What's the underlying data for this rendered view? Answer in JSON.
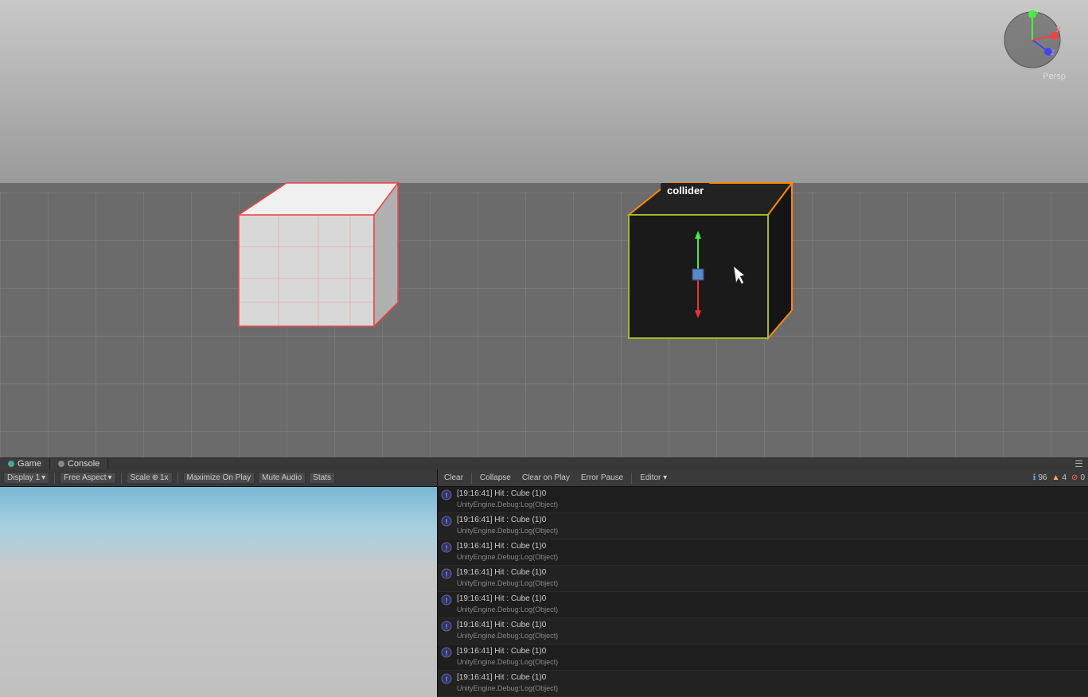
{
  "scene": {
    "persp_label": "Persp"
  },
  "collider_label": "collider",
  "tabs": {
    "game_tab": "Game",
    "console_tab": "Console",
    "game_menu_icon": "☰",
    "console_menu_icon": "☰"
  },
  "game_toolbar": {
    "display": "Display 1",
    "aspect": "Free Aspect",
    "scale_label": "Scale",
    "scale_value": "1x",
    "maximize": "Maximize On Play",
    "mute": "Mute Audio",
    "stats": "Stats"
  },
  "console_toolbar": {
    "clear": "Clear",
    "collapse": "Collapse",
    "clear_on_play": "Clear on Play",
    "error_pause": "Error Pause",
    "editor": "Editor ▾"
  },
  "console_badges": {
    "info_count": "96",
    "warn_count": "4",
    "err_count": "0"
  },
  "log_entries": [
    {
      "time": "[19:16:41]",
      "msg": "Hit : Cube (1)0",
      "detail": "UnityEngine.Debug:Log(Object)"
    },
    {
      "time": "[19:16:41]",
      "msg": "Hit : Cube (1)0",
      "detail": "UnityEngine.Debug:Log(Object)"
    },
    {
      "time": "[19:16:41]",
      "msg": "Hit : Cube (1)0",
      "detail": "UnityEngine.Debug:Log(Object)"
    },
    {
      "time": "[19:16:41]",
      "msg": "Hit : Cube (1)0",
      "detail": "UnityEngine.Debug:Log(Object)"
    },
    {
      "time": "[19:16:41]",
      "msg": "Hit : Cube (1)0",
      "detail": "UnityEngine.Debug:Log(Object)"
    },
    {
      "time": "[19:16:41]",
      "msg": "Hit : Cube (1)0",
      "detail": "UnityEngine.Debug:Log(Object)"
    },
    {
      "time": "[19:16:41]",
      "msg": "Hit : Cube (1)0",
      "detail": "UnityEngine.Debug:Log(Object)"
    },
    {
      "time": "[19:16:41]",
      "msg": "Hit : Cube (1)0",
      "detail": "UnityEngine.Debug:Log(Object)"
    }
  ]
}
